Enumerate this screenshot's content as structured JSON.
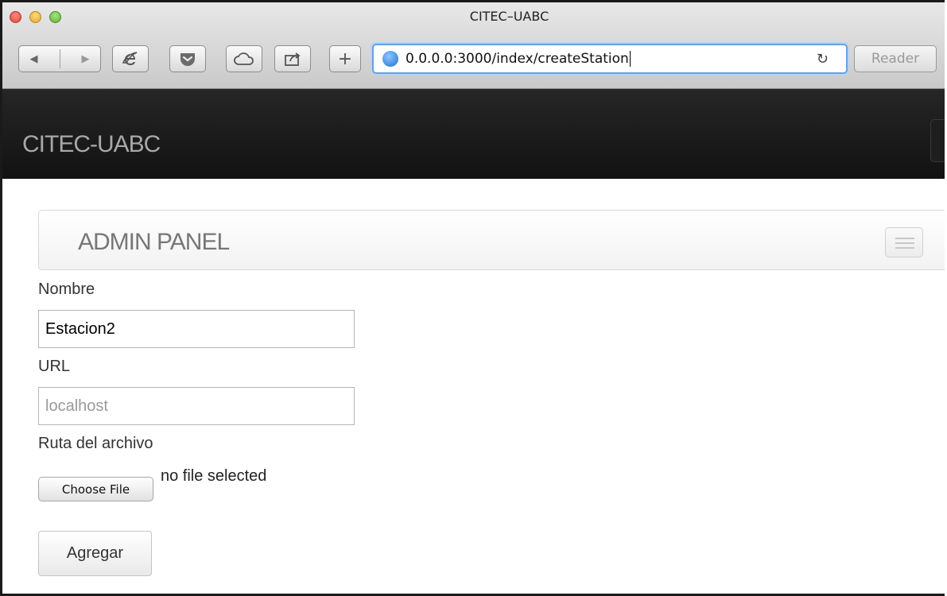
{
  "window": {
    "title": "CITEC–UABC"
  },
  "toolbar": {
    "url": "0.0.0.0:3000/index/createStation",
    "reader_label": "Reader",
    "add_tab_glyph": "+",
    "back_glyph": "◀",
    "forward_glyph": "▶",
    "reload_glyph": "↻",
    "icons": [
      "back-icon",
      "forward-icon",
      "ie-icon",
      "pocket-icon",
      "cloud-icon",
      "share-icon",
      "add-tab-icon",
      "globe-icon",
      "reload-icon"
    ]
  },
  "navbar": {
    "brand": "CITEC-UABC"
  },
  "panel": {
    "title": "ADMIN PANEL"
  },
  "form": {
    "name_label": "Nombre",
    "name_value": "Estacion2",
    "url_label": "URL",
    "url_placeholder": "localhost",
    "file_label": "Ruta del archivo",
    "file_button": "Choose File",
    "file_status": "no file selected",
    "submit_label": "Agregar"
  },
  "colors": {
    "navbar_bg": "#1b1b1b",
    "brand_text": "#a8a8a8",
    "url_focus": "#6aa0de"
  }
}
